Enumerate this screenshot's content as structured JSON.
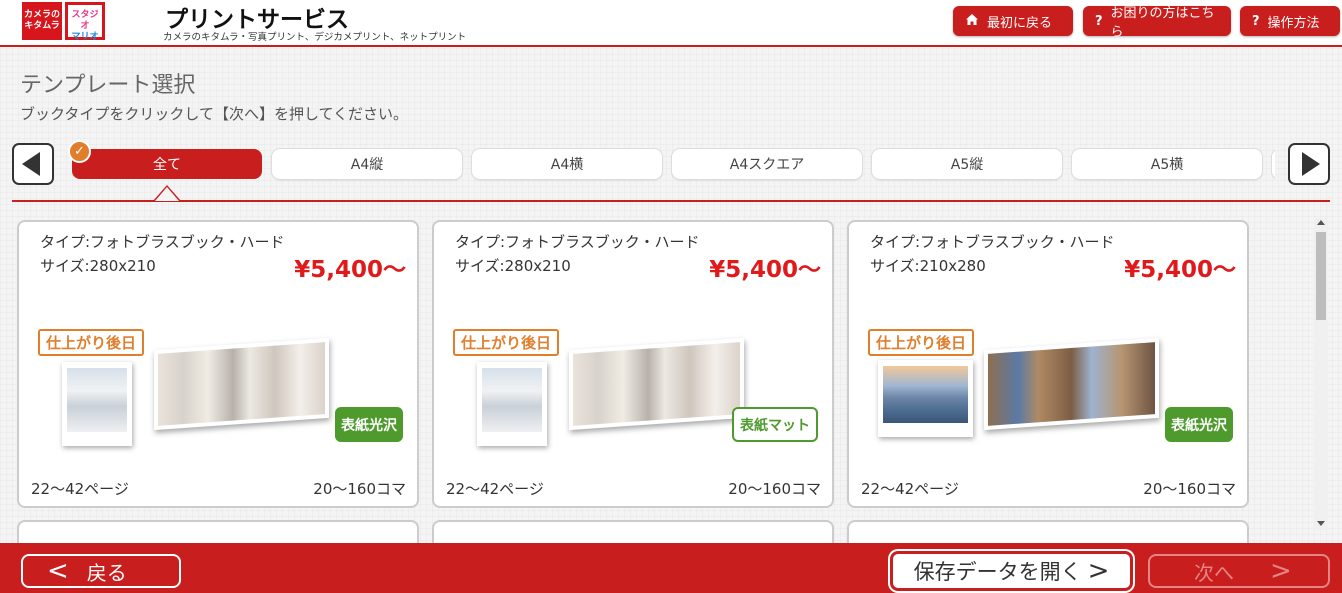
{
  "header": {
    "logo_primary": "カメラの\nキタムラ",
    "logo_secondary_top": "スタジオ",
    "logo_secondary_bottom": "マリオ",
    "title": "プリントサービス",
    "subtitle": "カメラのキタムラ・写真プリント、デジカメプリント、ネットプリント",
    "buttons": [
      {
        "label": "最初に戻る",
        "icon": "home-icon"
      },
      {
        "label": "お困りの方はこちら",
        "icon": "question-icon"
      },
      {
        "label": "操作方法",
        "icon": "question-icon"
      }
    ],
    "accent_color": "#c81e1e"
  },
  "page": {
    "title": "テンプレート選択",
    "instruction": "ブックタイプをクリックして【次へ】を押してください。"
  },
  "tabs": {
    "items": [
      "全て",
      "A4縦",
      "A4横",
      "A4スクエア",
      "A5縦",
      "A5横"
    ],
    "selected_index": 0,
    "prev_icon": "triangle-left-icon",
    "next_icon": "triangle-right-icon",
    "check_icon": "check-icon"
  },
  "cards": [
    {
      "type": "タイプ:フォトブラスブック・ハード",
      "size": "サイズ:280x210",
      "price": "¥5,400〜",
      "late_badge": "仕上がり後日",
      "cover_badge": "表紙光沢",
      "cover_style": "filled",
      "pages": "22〜42ページ",
      "frames": "20〜160コマ",
      "image": "wedding"
    },
    {
      "type": "タイプ:フォトブラスブック・ハード",
      "size": "サイズ:280x210",
      "price": "¥5,400〜",
      "late_badge": "仕上がり後日",
      "cover_badge": "表紙マット",
      "cover_style": "outline",
      "pages": "22〜42ページ",
      "frames": "20〜160コマ",
      "image": "wedding"
    },
    {
      "type": "タイプ:フォトブラスブック・ハード",
      "size": "サイズ:210x280",
      "price": "¥5,400〜",
      "late_badge": "仕上がり後日",
      "cover_badge": "表紙光沢",
      "cover_style": "filled",
      "pages": "22〜42ページ",
      "frames": "20〜160コマ",
      "image": "travel"
    }
  ],
  "footer": {
    "back_label": "戻る",
    "open_label": "保存データを開く",
    "next_label": "次へ",
    "next_enabled": false
  }
}
